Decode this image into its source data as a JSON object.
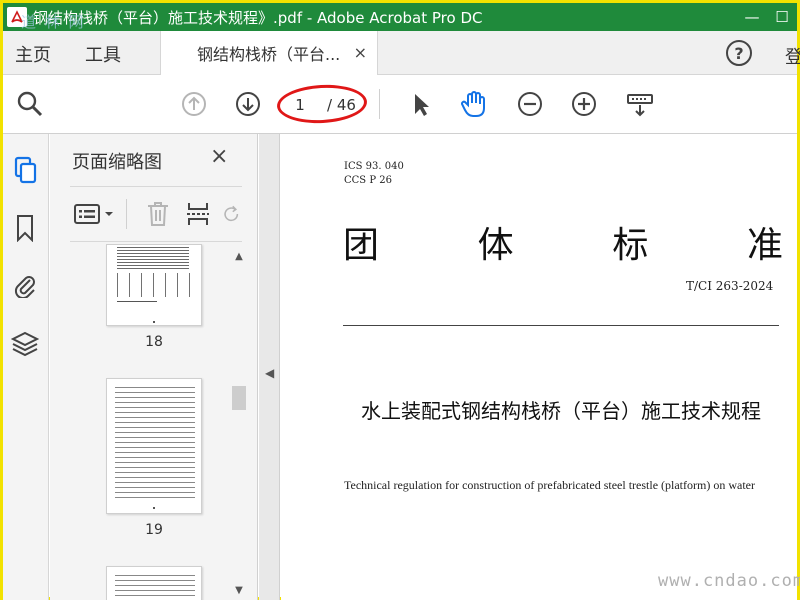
{
  "window": {
    "title": "钢结构栈桥（平台）施工技术规程》.pdf - Adobe Acrobat Pro DC",
    "minimize": "—",
    "maximize": "☐",
    "app_icon": "acrobat-icon"
  },
  "watermark": {
    "top": "道 林 网",
    "bottom": "www.cndao.com"
  },
  "menu": {
    "home": "主页",
    "tools": "工具",
    "doc_tab": "钢结构栈桥（平台...",
    "doc_tab_close": "×",
    "help": "?",
    "signin": "登"
  },
  "toolbar": {
    "current_page": "1",
    "total_pages": "/ 46",
    "icons": [
      "search-icon",
      "prev-page-icon",
      "next-page-icon",
      "select-arrow-icon",
      "hand-tool-icon",
      "zoom-out-icon",
      "zoom-in-icon",
      "scroll-mode-icon"
    ]
  },
  "rail": {
    "icons": [
      "page-thumbnails-icon",
      "bookmark-icon",
      "attachment-icon",
      "layers-icon"
    ]
  },
  "thumbnail_panel": {
    "title": "页面缩略图",
    "close": "×",
    "pages": [
      {
        "label": "18"
      },
      {
        "label": "19"
      }
    ]
  },
  "document": {
    "ics": "ICS 93. 040",
    "ccs": "CCS P 26",
    "title_chars": [
      "团",
      "体",
      "标",
      "准"
    ],
    "std_number": "T/CI 263-2024",
    "name_cn": "水上装配式钢结构栈桥（平台）施工技术规程",
    "name_en": "Technical regulation for construction of prefabricated steel trestle (platform) on water"
  },
  "colors": {
    "titlebar": "#1f8a3b",
    "frame": "#f2e200",
    "accent_blue": "#1473e6",
    "annotation_red": "#e01717"
  }
}
